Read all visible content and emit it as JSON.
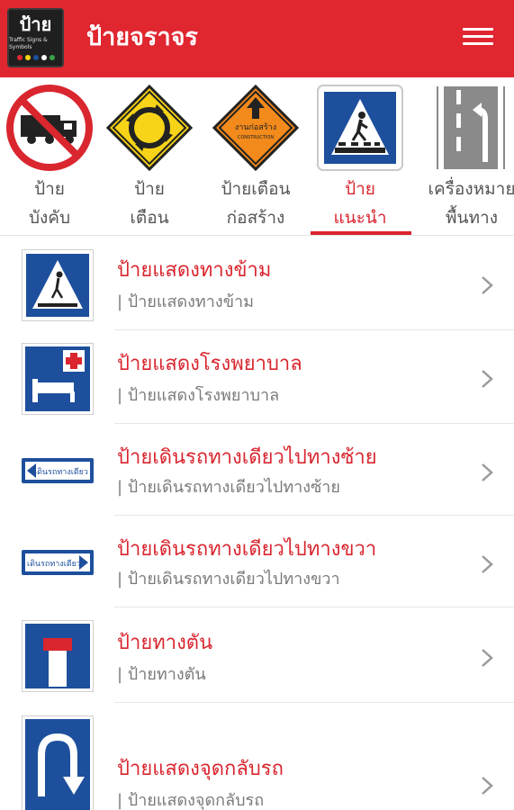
{
  "app": {
    "logo_text": "ป้าย",
    "logo_subtext": "Traffic Signs & Symbols",
    "title": "ป้ายจราจร",
    "menu_icon": "hamburger-menu-icon"
  },
  "categories": [
    {
      "label": "ป้าย\nบังคับ",
      "icon": "no-trucks-sign-icon",
      "active": false
    },
    {
      "label": "ป้าย\nเตือน",
      "icon": "roundabout-warning-sign-icon",
      "active": false
    },
    {
      "label": "ป้ายเตือน\nก่อสร้าง",
      "icon": "construction-warning-sign-icon",
      "active": false
    },
    {
      "label": "ป้าย\nแนะนำ",
      "icon": "pedestrian-crossing-sign-icon",
      "active": true
    },
    {
      "label": "เครื่องหมาย\nพื้นทาง",
      "icon": "road-marking-sign-icon",
      "active": false
    }
  ],
  "construction_sign_text": "งานก่อสร้าง",
  "construction_sign_subtext": "CONSTRUCTION",
  "one_way_sign_text": "เดินรถทางเดียว",
  "items": [
    {
      "title": "ป้ายแสดงทางข้าม",
      "subtitle": "| ป้ายแสดงทางข้าม",
      "icon": "pedestrian-crossing-icon"
    },
    {
      "title": "ป้ายแสดงโรงพยาบาล",
      "subtitle": "| ป้ายแสดงโรงพยาบาล",
      "icon": "hospital-sign-icon"
    },
    {
      "title": "ป้ายเดินรถทางเดียวไปทางซ้าย",
      "subtitle": "| ป้ายเดินรถทางเดียวไปทางซ้าย",
      "icon": "one-way-left-sign-icon"
    },
    {
      "title": "ป้ายเดินรถทางเดียวไปทางขวา",
      "subtitle": "| ป้ายเดินรถทางเดียวไปทางขวา",
      "icon": "one-way-right-sign-icon"
    },
    {
      "title": "ป้ายทางตัน",
      "subtitle": "| ป้ายทางตัน",
      "icon": "dead-end-sign-icon"
    },
    {
      "title": "ป้ายแสดงจุดกลับรถ",
      "subtitle": "| ป้ายแสดงจุดกลับรถ",
      "icon": "u-turn-sign-icon"
    }
  ],
  "colors": {
    "appbar": "#e0262f",
    "accent_red": "#d9262f",
    "sign_blue": "#1d4f9c",
    "warning_yellow": "#f7d417",
    "construction_orange": "#f28a1c"
  }
}
